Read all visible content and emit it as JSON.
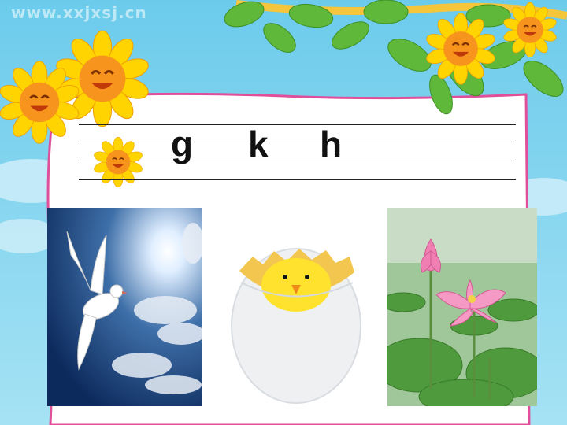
{
  "watermark": "www.xxjxsj.cn",
  "letters": [
    "g",
    "k",
    "h"
  ],
  "images": [
    {
      "subject": "dove in sky"
    },
    {
      "subject": "chick hatching from egg"
    },
    {
      "subject": "lotus flowers"
    }
  ],
  "colors": {
    "sky": "#7fd0ee",
    "board": "#ffffff",
    "board_border": "#e0509a",
    "leaf": "#5fb83a",
    "sunflower_petal": "#ffd400",
    "sunflower_face": "#f7941d"
  }
}
